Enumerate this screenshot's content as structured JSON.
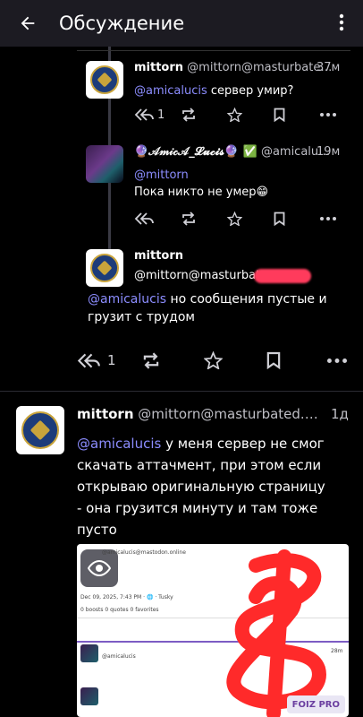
{
  "appbar": {
    "title": "Обсуждение",
    "back_icon": "arrow-left-icon",
    "more_icon": "more-vert-icon"
  },
  "colors": {
    "mention": "#8c8dff",
    "appbar_bg": "#1c1b22",
    "censor": "#ff3b5c"
  },
  "posts": [
    {
      "name": "mittorn",
      "handle": "@mittorn@masturbate…",
      "time": "37м",
      "mention": "@amicalucis",
      "text": " сервер умир?",
      "reply_count": "1"
    },
    {
      "name": "🔮𝒜𝓂𝒾𝒸𝒜_𝓛𝓾𝓬𝓲𝓼🔮 ✅",
      "handle": "@amicalu…",
      "time": "19м",
      "mention": "@mittorn",
      "text": "Пока никто не умер😁"
    },
    {
      "name": "mittorn",
      "handle": "@mittorn@masturbate",
      "mention": "@amicalucis",
      "text_line1": " но сообщения пустые и",
      "text_line2": "грузит с трудом",
      "reply_count": "1"
    }
  ],
  "main_post": {
    "name": "mittorn",
    "handle": "@mittorn@masturbated.…",
    "time": "1д",
    "mention": "@amicalucis",
    "line1": " у меня сервер не смог",
    "line2": "скачать аттачмент, при этом если",
    "line3": "открываю оригинальную страницу",
    "line4": "- она грузится минуту и там тоже",
    "line5": "пусто"
  },
  "attachment": {
    "l1": "@amicalucis@mastodon.online",
    "l2": "Dec 09, 2025, 7:43 PM  ·  🌐  ·  Tusky",
    "l3": "0 boosts   0 quotes   0 favorites",
    "l4": "@amicalucis",
    "time2": "28m"
  },
  "watermark": "FOIZ PRO"
}
